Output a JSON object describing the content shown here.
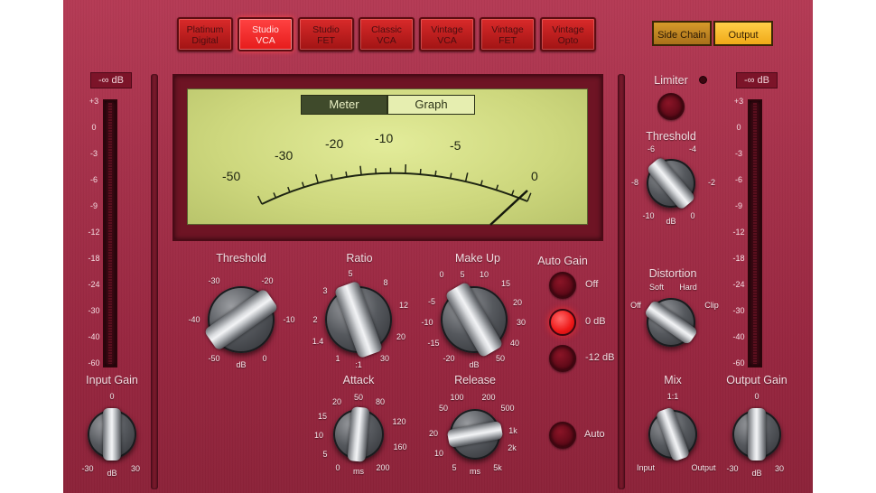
{
  "presets": [
    {
      "label": "Platinum\nDigital",
      "active": false
    },
    {
      "label": "Studio\nVCA",
      "active": true
    },
    {
      "label": "Studio\nFET",
      "active": false
    },
    {
      "label": "Classic\nVCA",
      "active": false
    },
    {
      "label": "Vintage\nVCA",
      "active": false
    },
    {
      "label": "Vintage\nFET",
      "active": false
    },
    {
      "label": "Vintage\nOpto",
      "active": false
    }
  ],
  "view_toggle": {
    "side_chain": "Side Chain",
    "output": "Output",
    "selected": "output"
  },
  "display": {
    "meter_tab": "Meter",
    "graph_tab": "Graph",
    "selected": "meter",
    "scale": [
      "-50",
      "-30",
      "-20",
      "-10",
      "-5",
      "0"
    ],
    "needle_value_db": 0
  },
  "input_meter": {
    "readout": "-∞ dB",
    "scale": [
      "+3",
      "0",
      "-3",
      "-6",
      "-9",
      "-12",
      "-18",
      "-24",
      "-30",
      "-40",
      "-60"
    ]
  },
  "output_meter": {
    "readout": "-∞ dB",
    "scale": [
      "+3",
      "0",
      "-3",
      "-6",
      "-9",
      "-12",
      "-18",
      "-24",
      "-30",
      "-40",
      "-60"
    ]
  },
  "limiter": {
    "label": "Limiter",
    "enabled": false
  },
  "limiter_threshold": {
    "label": "Threshold",
    "ticks": [
      "-6",
      "-4",
      "-8",
      "-2",
      "-10",
      "dB",
      "0"
    ]
  },
  "distortion": {
    "label": "Distortion",
    "ticks": [
      "Soft",
      "Hard",
      "Off",
      "Clip"
    ]
  },
  "mix": {
    "label": "Mix",
    "ticks": [
      "1:1",
      "Input",
      "Output"
    ]
  },
  "output_gain": {
    "label": "Output Gain",
    "ticks": [
      "0",
      "-30",
      "dB",
      "30"
    ]
  },
  "input_gain": {
    "label": "Input Gain",
    "ticks": [
      "0",
      "-30",
      "dB",
      "30"
    ]
  },
  "threshold": {
    "label": "Threshold",
    "ticks": [
      "-30",
      "-20",
      "-40",
      "-10",
      "-50",
      "dB",
      "0"
    ]
  },
  "ratio": {
    "label": "Ratio",
    "ticks": [
      "5",
      "3",
      "8",
      "12",
      "2",
      "20",
      "1.4",
      "1",
      ":1",
      "30"
    ]
  },
  "makeup": {
    "label": "Make Up",
    "ticks": [
      "0",
      "5",
      "10",
      "15",
      "-5",
      "20",
      "-10",
      "30",
      "-15",
      "40",
      "-20",
      "dB",
      "50"
    ]
  },
  "attack": {
    "label": "Attack",
    "ticks": [
      "20",
      "50",
      "80",
      "15",
      "120",
      "10",
      "160",
      "5",
      "0",
      "ms",
      "200"
    ]
  },
  "release": {
    "label": "Release",
    "ticks": [
      "100",
      "200",
      "50",
      "500",
      "1k",
      "20",
      "2k",
      "10",
      "5",
      "ms",
      "5k"
    ]
  },
  "auto_gain": {
    "label": "Auto Gain",
    "options": [
      "Off",
      "0 dB",
      "-12 dB"
    ],
    "selected": "0 dB"
  },
  "auto_release": {
    "label": "Auto",
    "enabled": false
  }
}
